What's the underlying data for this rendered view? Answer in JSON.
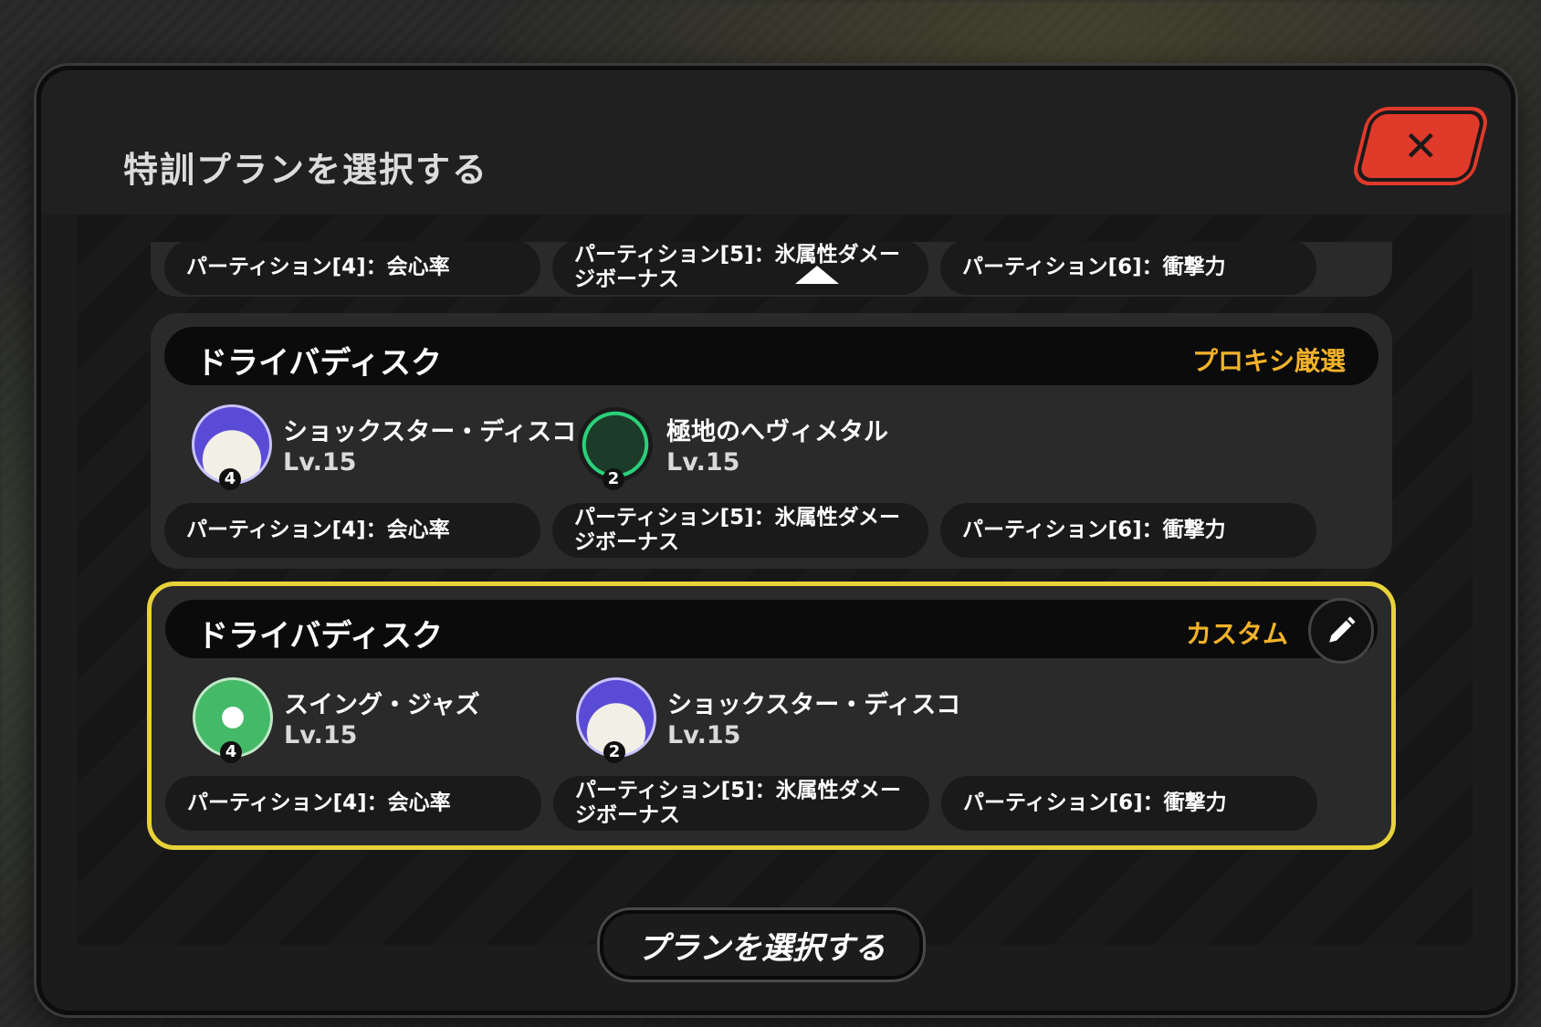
{
  "modal": {
    "title": "特訓プランを選択する",
    "close_icon": "close-icon"
  },
  "top_partial": {
    "stats": [
      "パーティション[4]：会心率",
      "パーティション[5]：氷属性ダメージボーナス",
      "パーティション[6]：衝撃力"
    ],
    "scroll_icon": "scroll-up-arrow-icon"
  },
  "plans": [
    {
      "title": "ドライバディスク",
      "tag": "プロキシ厳選",
      "discs": [
        {
          "name": "ショックスター・ディスコ",
          "level": "Lv.15",
          "count": "4",
          "icon": "shockstar-disco-icon"
        },
        {
          "name": "極地のへヴィメタル",
          "level": "Lv.15",
          "count": "2",
          "icon": "polar-metal-icon"
        }
      ],
      "stats": [
        "パーティション[4]：会心率",
        "パーティション[5]：氷属性ダメージボーナス",
        "パーティション[6]：衝撃力"
      ]
    },
    {
      "title": "ドライバディスク",
      "tag": "カスタム",
      "selected": true,
      "edit_icon": "pencil-icon",
      "discs": [
        {
          "name": "スイング・ジャズ",
          "level": "Lv.15",
          "count": "4",
          "icon": "swing-jazz-icon"
        },
        {
          "name": "ショックスター・ディスコ",
          "level": "Lv.15",
          "count": "2",
          "icon": "shockstar-disco-icon"
        }
      ],
      "stats": [
        "パーティション[4]：会心率",
        "パーティション[5]：氷属性ダメージボーナス",
        "パーティション[6]：衝撃力"
      ]
    }
  ],
  "footer": {
    "select_label": "プランを選択する"
  },
  "colors": {
    "accent_yellow": "#e7d23a",
    "tag_orange": "#f2b22a",
    "close_red": "#e03a2a"
  }
}
